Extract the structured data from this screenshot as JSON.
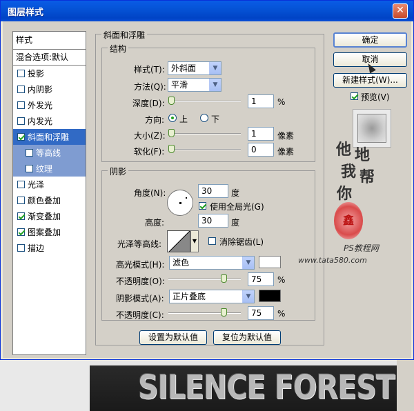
{
  "window": {
    "title": "图层样式",
    "close": "✕"
  },
  "style_list": {
    "header": "样式",
    "blend": "混合选项:默认",
    "items": [
      {
        "label": "投影",
        "checked": false
      },
      {
        "label": "内阴影",
        "checked": false
      },
      {
        "label": "外发光",
        "checked": false
      },
      {
        "label": "内发光",
        "checked": false
      },
      {
        "label": "斜面和浮雕",
        "checked": true
      },
      {
        "label": "等高线",
        "checked": false
      },
      {
        "label": "纹理",
        "checked": false
      },
      {
        "label": "光泽",
        "checked": false
      },
      {
        "label": "颜色叠加",
        "checked": false
      },
      {
        "label": "渐变叠加",
        "checked": true
      },
      {
        "label": "图案叠加",
        "checked": true
      },
      {
        "label": "描边",
        "checked": false
      }
    ]
  },
  "bevel": {
    "title": "斜面和浮雕",
    "structure": {
      "title": "结构",
      "style_label": "样式(T):",
      "style_value": "外斜面",
      "method_label": "方法(Q):",
      "method_value": "平滑",
      "depth_label": "深度(D):",
      "depth_value": "1",
      "depth_unit": "%",
      "direction_label": "方向:",
      "dir_up": "上",
      "dir_down": "下",
      "size_label": "大小(Z):",
      "size_value": "1",
      "size_unit": "像素",
      "soften_label": "软化(F):",
      "soften_value": "0",
      "soften_unit": "像素"
    },
    "shading": {
      "title": "阴影",
      "angle_label": "角度(N):",
      "angle_value": "30",
      "angle_unit": "度",
      "global_light": "使用全局光(G)",
      "altitude_label": "高度:",
      "altitude_value": "30",
      "altitude_unit": "度",
      "gloss_label": "光泽等高线:",
      "antialias": "消除锯齿(L)",
      "highlight_label": "高光模式(H):",
      "highlight_value": "滤色",
      "hl_opacity_label": "不透明度(O):",
      "hl_opacity_value": "75",
      "hl_opacity_unit": "%",
      "shadow_label": "阴影模式(A):",
      "shadow_value": "正片叠底",
      "sh_opacity_label": "不透明度(C):",
      "sh_opacity_value": "75",
      "sh_opacity_unit": "%"
    },
    "make_default": "设置为默认值",
    "reset_default": "复位为默认值"
  },
  "buttons": {
    "ok": "确定",
    "cancel": "取消",
    "new_style": "新建样式(W)...",
    "preview": "预览(V)"
  },
  "watermark": {
    "c1": "他",
    "c2": "地",
    "c3": "我",
    "c4": "帮",
    "c5": "你",
    "site_name": "PS教程网",
    "site_url": "www.tata580.com",
    "seal": "鑫"
  },
  "background": {
    "text": "SILENCE FOREST"
  },
  "colors": {
    "highlight": "#ffffff",
    "shadow": "#000000",
    "selection": "#316ac5"
  }
}
